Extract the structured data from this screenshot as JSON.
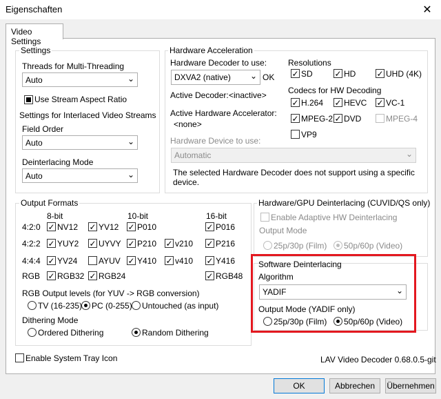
{
  "window": {
    "title": "Eigenschaften",
    "close_icon": "close-icon"
  },
  "tab": {
    "label": "Video Settings"
  },
  "settings": {
    "title": "Settings",
    "threads_label": "Threads for Multi-Threading",
    "threads_value": "Auto",
    "stream_aspect": {
      "label": "Use Stream Aspect Ratio",
      "checked": true
    },
    "interlaced_label": "Settings for Interlaced Video Streams",
    "field_order_label": "Field Order",
    "field_order_value": "Auto",
    "deint_mode_label": "Deinterlacing Mode",
    "deint_mode_value": "Auto"
  },
  "hwaccel": {
    "title": "Hardware Acceleration",
    "decoder_label": "Hardware Decoder to use:",
    "decoder_value": "DXVA2 (native)",
    "ok_label": "OK",
    "active_decoder_label": "Active Decoder:",
    "active_decoder_value": "<inactive>",
    "active_accel_label": "Active Hardware Accelerator:",
    "active_accel_value": "<none>",
    "device_label": "Hardware Device to use:",
    "device_value": "Automatic",
    "device_note": "The selected Hardware Decoder does not support using a specific device.",
    "resolutions_label": "Resolutions",
    "resolutions": [
      {
        "label": "SD",
        "checked": true
      },
      {
        "label": "HD",
        "checked": true
      },
      {
        "label": "UHD (4K)",
        "checked": true
      }
    ],
    "codecs_label": "Codecs for HW Decoding",
    "codecs": [
      {
        "label": "H.264",
        "checked": true
      },
      {
        "label": "HEVC",
        "checked": true
      },
      {
        "label": "VC-1",
        "checked": true
      },
      {
        "label": "MPEG-2",
        "checked": true
      },
      {
        "label": "DVD",
        "checked": true
      },
      {
        "label": "MPEG-4",
        "checked": false,
        "disabled": true
      },
      {
        "label": "VP9",
        "checked": false
      }
    ]
  },
  "output_formats": {
    "title": "Output Formats",
    "col_8bit": "8-bit",
    "col_10bit": "10-bit",
    "col_16bit": "16-bit",
    "rows": [
      {
        "label": "4:2:0",
        "items": [
          {
            "label": "NV12",
            "checked": true
          },
          {
            "label": "YV12",
            "checked": true
          },
          {
            "label": "P010",
            "checked": true
          },
          {
            "label": "P016",
            "checked": true
          }
        ]
      },
      {
        "label": "4:2:2",
        "items": [
          {
            "label": "YUY2",
            "checked": true
          },
          {
            "label": "UYVY",
            "checked": true
          },
          {
            "label": "P210",
            "checked": true
          },
          {
            "label": "v210",
            "checked": true
          },
          {
            "label": "P216",
            "checked": true
          }
        ]
      },
      {
        "label": "4:4:4",
        "items": [
          {
            "label": "YV24",
            "checked": true
          },
          {
            "label": "AYUV",
            "checked": false
          },
          {
            "label": "Y410",
            "checked": true
          },
          {
            "label": "v410",
            "checked": true
          },
          {
            "label": "Y416",
            "checked": true
          }
        ]
      },
      {
        "label": "RGB",
        "items": [
          {
            "label": "RGB32",
            "checked": true
          },
          {
            "label": "RGB24",
            "checked": true
          },
          {
            "label": "RGB48",
            "checked": true
          }
        ]
      }
    ],
    "rgb_levels_label": "RGB Output levels (for YUV -> RGB conversion)",
    "rgb_levels": [
      {
        "label": "TV (16-235)",
        "selected": false
      },
      {
        "label": "PC (0-255)",
        "selected": true
      },
      {
        "label": "Untouched (as input)",
        "selected": false
      }
    ],
    "dither_label": "Dithering Mode",
    "dither": [
      {
        "label": "Ordered Dithering",
        "selected": false
      },
      {
        "label": "Random Dithering",
        "selected": true
      }
    ]
  },
  "hw_deint": {
    "title": "Hardware/GPU Deinterlacing (CUVID/QS only)",
    "adaptive_label": "Enable Adaptive HW Deinterlacing",
    "output_mode_label": "Output Mode",
    "options": [
      {
        "label": "25p/30p (Film)",
        "selected": false
      },
      {
        "label": "50p/60p (Video)",
        "selected": true
      }
    ]
  },
  "sw_deint": {
    "title": "Software Deinterlacing",
    "algorithm_label": "Algorithm",
    "algorithm_value": "YADIF",
    "output_mode_label": "Output Mode (YADIF only)",
    "options": [
      {
        "label": "25p/30p (Film)",
        "selected": false
      },
      {
        "label": "50p/60p (Video)",
        "selected": true
      }
    ],
    "highlight_color": "#e3171f"
  },
  "tray_icon": {
    "label": "Enable System Tray Icon",
    "checked": false
  },
  "version": "LAV Video Decoder 0.68.0.5-git",
  "buttons": {
    "ok": "OK",
    "cancel": "Abbrechen",
    "apply": "Übernehmen"
  }
}
